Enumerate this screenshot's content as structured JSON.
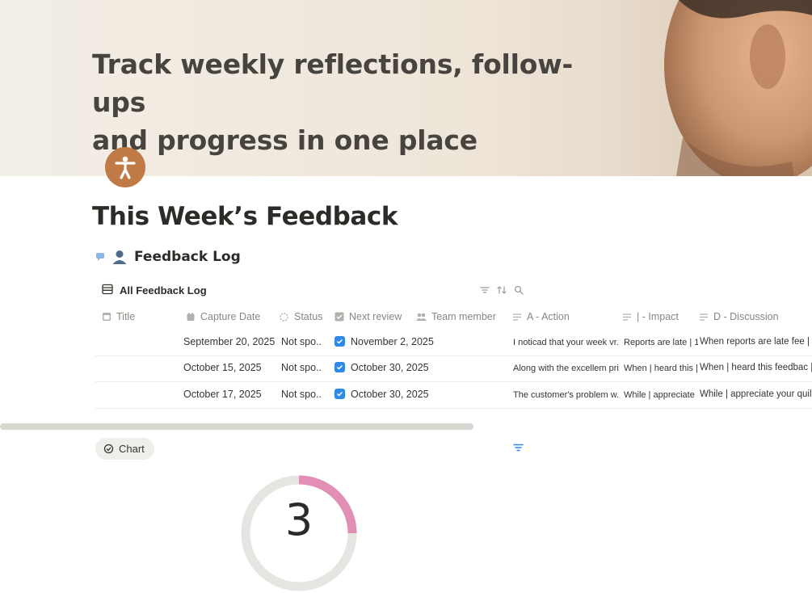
{
  "cover": {
    "title_line1": "Track weekly reflections, follow-ups",
    "title_line2": "and progress in one place"
  },
  "page": {
    "title": "This Week’s Feedback",
    "icon": "accessibility-person-icon"
  },
  "section": {
    "label": "Feedback Log",
    "icons": [
      "comment-icon",
      "person-icon"
    ]
  },
  "view": {
    "name": "All Feedback Log",
    "tools": [
      "filter-icon",
      "sort-icon",
      "search-icon"
    ]
  },
  "columns": [
    {
      "label": "Title",
      "icon": "table-icon"
    },
    {
      "label": "Capture Date",
      "icon": "calendar-icon"
    },
    {
      "label": "Status",
      "icon": "status-icon"
    },
    {
      "label": "Next review",
      "icon": "checkbox-icon"
    },
    {
      "label": "Team member",
      "icon": "people-icon"
    },
    {
      "label": "A - Action",
      "icon": "text-icon"
    },
    {
      "label": "| - Impact",
      "icon": "text-icon"
    },
    {
      "label": "D - Discussion",
      "icon": "text-icon"
    }
  ],
  "rows": [
    {
      "capture_date": "September 20, 2025",
      "status": "Not spo..",
      "next_review": "November 2, 2025",
      "action": "I noticad that your week vr.",
      "impact": "Reports are late | 1",
      "discussion": "When reports are late fee |"
    },
    {
      "capture_date": "October 15, 2025",
      "status": "Not spo..",
      "next_review": "October 30, 2025",
      "action": "Along with the excellem pri.",
      "impact": "When | heard this |",
      "discussion": "When | heard this feedbac |"
    },
    {
      "capture_date": "October 17, 2025",
      "status": "Not spo..",
      "next_review": "October 30, 2025",
      "action": "The customer's problem w.",
      "impact": "While | appreciate",
      "discussion": "While | appreciate your quil"
    }
  ],
  "chart_tab": {
    "label": "Chart"
  },
  "chart": {
    "value": "3",
    "colors": {
      "track": "#e6e5e1",
      "fill": "#e18fb4"
    }
  }
}
